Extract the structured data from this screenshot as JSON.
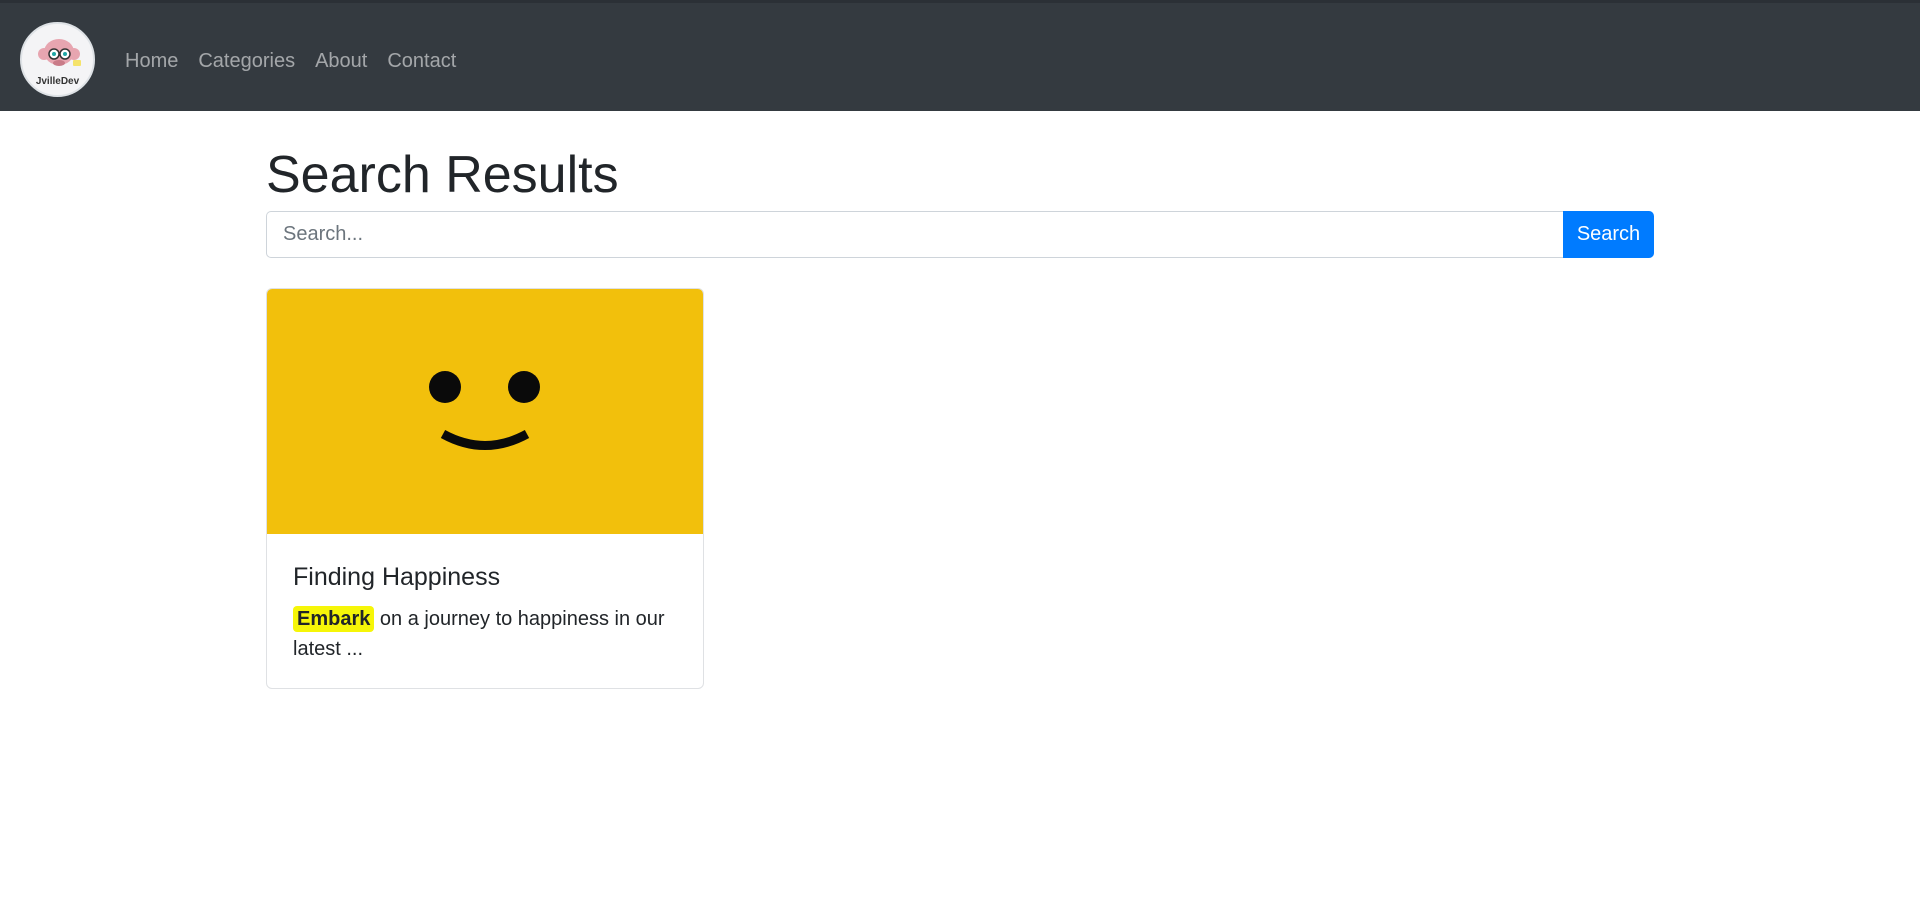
{
  "brand": {
    "logo_text": "JvilleDev",
    "logo_icon": "monkey-mascot-icon"
  },
  "nav": {
    "items": [
      {
        "label": "Home"
      },
      {
        "label": "Categories"
      },
      {
        "label": "About"
      },
      {
        "label": "Contact"
      }
    ]
  },
  "page": {
    "title": "Search Results"
  },
  "search": {
    "placeholder": "Search...",
    "value": "",
    "button_label": "Search"
  },
  "results": [
    {
      "title": "Finding Happiness",
      "highlight": "Embark",
      "excerpt_rest": " on a journey to happiness in our latest ...",
      "image_icon": "smiley-face-icon"
    }
  ],
  "colors": {
    "navbar": "#343a40",
    "accent": "#007bff",
    "card_image_bg": "#f2c00c",
    "highlight": "#f6f608"
  }
}
